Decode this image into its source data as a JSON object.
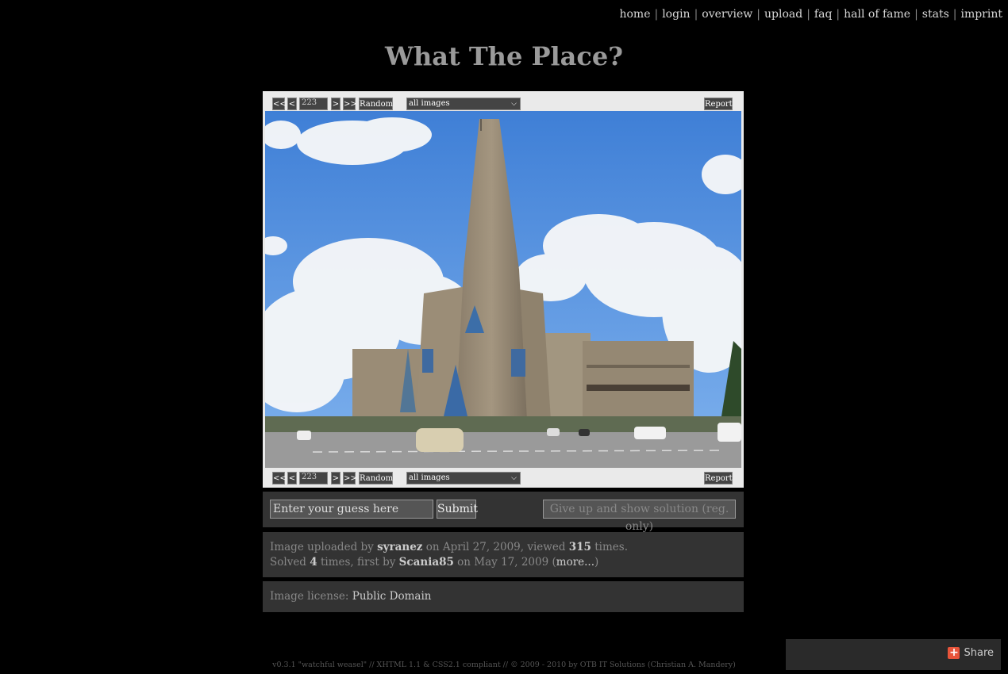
{
  "nav": {
    "items": [
      "home",
      "login",
      "overview",
      "upload",
      "faq",
      "hall of fame",
      "stats",
      "imprint"
    ],
    "separator": "|"
  },
  "title": "What The Place?",
  "controls": {
    "first": "<<",
    "prev": "<",
    "image_number": "223",
    "next": ">",
    "last": ">>",
    "random": "Random",
    "filter_selected": "all images",
    "report": "Report"
  },
  "guess": {
    "placeholder": "Enter your guess here",
    "submit": "Submit",
    "give_up": "Give up and show solution (reg. only)"
  },
  "info": {
    "uploaded_prefix": "Image uploaded by",
    "uploader": "syranez",
    "uploaded_mid": "on April 27, 2009, viewed",
    "views": "315",
    "views_suffix": "times.",
    "solved_prefix": "Solved",
    "solved_count": "4",
    "solved_mid": "times, first by",
    "first_solver": "Scania85",
    "solved_date": "on May 17, 2009 (",
    "more": "more...",
    "close_paren": ")"
  },
  "license": {
    "label": "Image license:",
    "value": "Public Domain"
  },
  "footer": "v0.3.1 \"watchful weasel\" // XHTML 1.1 & CSS2.1 compliant // © 2009 - 2010 by OTB IT Solutions (Christian A. Mandery)",
  "share": {
    "label": "Share",
    "icon": "plus-icon",
    "icon_glyph": "+"
  }
}
